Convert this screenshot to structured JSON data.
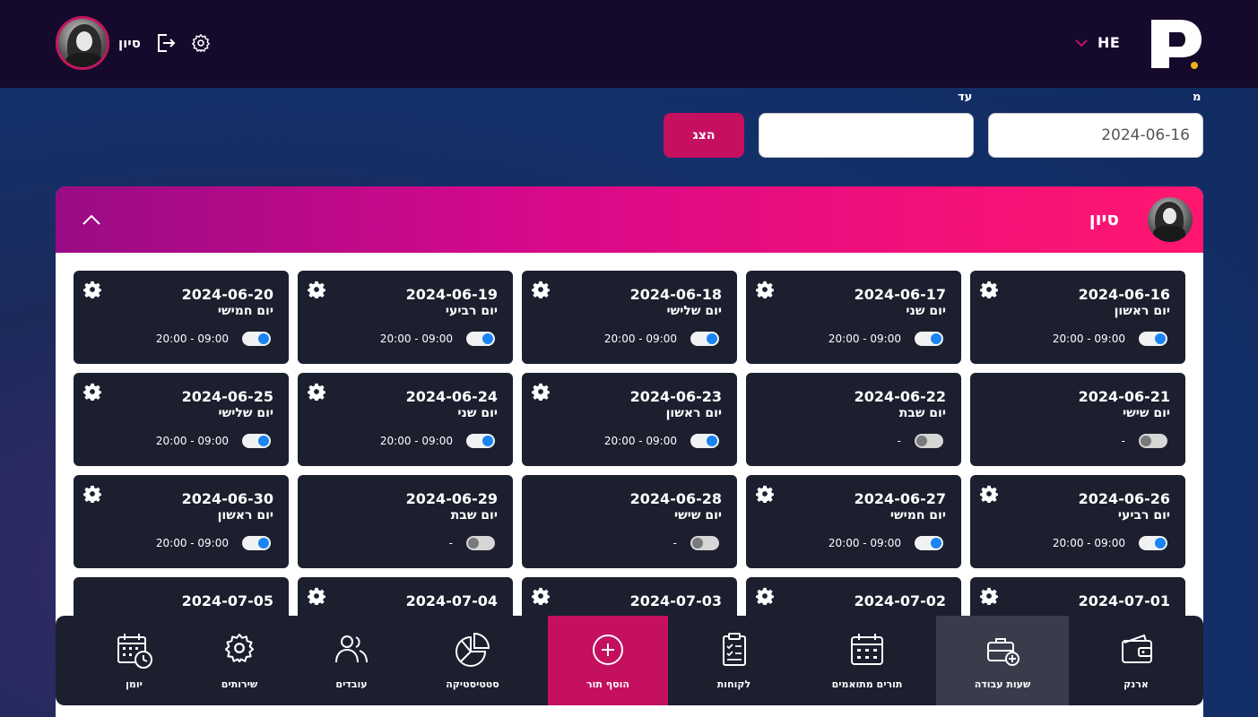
{
  "header": {
    "user_name": "סיון",
    "language": "HE"
  },
  "filter": {
    "from_label": "מ",
    "to_label": "עד",
    "from_value": "2024-06-16",
    "to_value": "",
    "show_button": "הצג"
  },
  "panel": {
    "employee_name": "סיון"
  },
  "days": [
    {
      "date": "2024-06-16",
      "name": "יום ראשון",
      "hours": "20:00 - 09:00",
      "enabled": true
    },
    {
      "date": "2024-06-17",
      "name": "יום שני",
      "hours": "20:00 - 09:00",
      "enabled": true
    },
    {
      "date": "2024-06-18",
      "name": "יום שלישי",
      "hours": "20:00 - 09:00",
      "enabled": true
    },
    {
      "date": "2024-06-19",
      "name": "יום רביעי",
      "hours": "20:00 - 09:00",
      "enabled": true
    },
    {
      "date": "2024-06-20",
      "name": "יום חמישי",
      "hours": "20:00 - 09:00",
      "enabled": true
    },
    {
      "date": "2024-06-21",
      "name": "יום שישי",
      "hours": "-",
      "enabled": false
    },
    {
      "date": "2024-06-22",
      "name": "יום שבת",
      "hours": "-",
      "enabled": false
    },
    {
      "date": "2024-06-23",
      "name": "יום ראשון",
      "hours": "20:00 - 09:00",
      "enabled": true
    },
    {
      "date": "2024-06-24",
      "name": "יום שני",
      "hours": "20:00 - 09:00",
      "enabled": true
    },
    {
      "date": "2024-06-25",
      "name": "יום שלישי",
      "hours": "20:00 - 09:00",
      "enabled": true
    },
    {
      "date": "2024-06-26",
      "name": "יום רביעי",
      "hours": "20:00 - 09:00",
      "enabled": true
    },
    {
      "date": "2024-06-27",
      "name": "יום חמישי",
      "hours": "20:00 - 09:00",
      "enabled": true
    },
    {
      "date": "2024-06-28",
      "name": "יום שישי",
      "hours": "-",
      "enabled": false
    },
    {
      "date": "2024-06-29",
      "name": "יום שבת",
      "hours": "-",
      "enabled": false
    },
    {
      "date": "2024-06-30",
      "name": "יום ראשון",
      "hours": "20:00 - 09:00",
      "enabled": true
    },
    {
      "date": "2024-07-01",
      "name": "",
      "hours": "",
      "enabled": true
    },
    {
      "date": "2024-07-02",
      "name": "",
      "hours": "",
      "enabled": true
    },
    {
      "date": "2024-07-03",
      "name": "",
      "hours": "",
      "enabled": true
    },
    {
      "date": "2024-07-04",
      "name": "",
      "hours": "",
      "enabled": true
    },
    {
      "date": "2024-07-05",
      "name": "",
      "hours": "",
      "enabled": false
    }
  ],
  "nav": {
    "wallet": "ארנק",
    "work_hours": "שעות עבודה",
    "booked_appointments": "תורים מתואמים",
    "customers": "לקוחות",
    "add_appointment": "הוסף תור",
    "statistics": "סטטיסטיקה",
    "employees": "עובדים",
    "services": "שירותים",
    "calendar": "יומן"
  },
  "colors": {
    "accent": "#c4105f",
    "header_bg": "#150a2c",
    "card_bg": "#1b1f2e",
    "toggle_on": "#1a84f0"
  }
}
